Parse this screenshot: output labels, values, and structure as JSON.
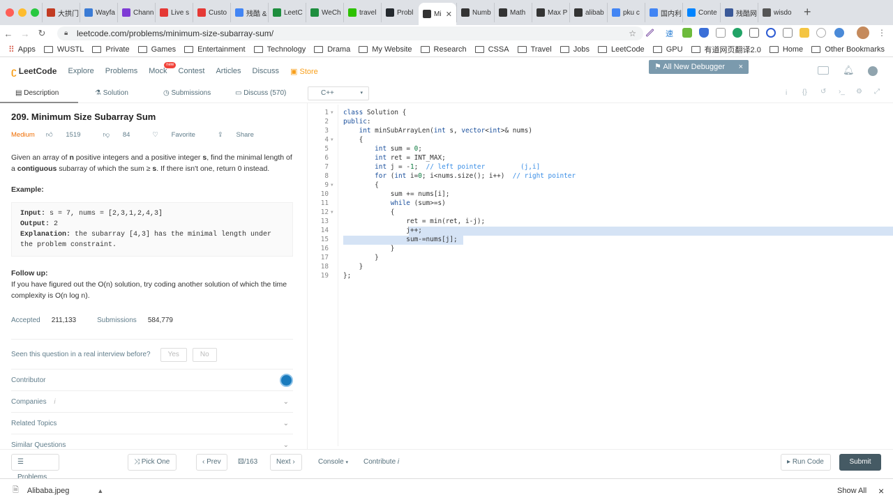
{
  "browser": {
    "tabs": [
      "大拱门",
      "Wayfa",
      "Chann",
      "Live s",
      "Custo",
      "残酷 &",
      "LeetC",
      "WeCh",
      "travel",
      "Probl",
      "Mi",
      "Numb",
      "Math",
      "Max P",
      "alibab",
      "pku c",
      "国内利",
      "Conte",
      "残酷网",
      "wisdo"
    ],
    "active_tab_index": 10,
    "url": "leetcode.com/problems/minimum-size-subarray-sum/",
    "bookmarks": [
      "Apps",
      "WUSTL",
      "Private",
      "Games",
      "Entertainment",
      "Technology",
      "Drama",
      "My Website",
      "Research",
      "CSSA",
      "Travel",
      "Jobs",
      "LeetCode",
      "GPU",
      "有道网页翻译2.0",
      "Home"
    ],
    "other_bookmarks": "Other Bookmarks"
  },
  "lc": {
    "logo": "LeetCode",
    "nav": [
      "Explore",
      "Problems",
      "Mock",
      "Contest",
      "Articles",
      "Discuss",
      "Store"
    ],
    "mock_badge": "new",
    "promo": "All New Debugger"
  },
  "subtabs": {
    "description": "Description",
    "solution": "Solution",
    "submissions": "Submissions",
    "discuss": "Discuss (570)",
    "language": "C++"
  },
  "problem": {
    "title": "209. Minimum Size Subarray Sum",
    "difficulty": "Medium",
    "likes": "1519",
    "dislikes": "84",
    "favorite": "Favorite",
    "share": "Share",
    "desc_1": "Given an array of ",
    "desc_n": "n",
    "desc_2": " positive integers and a positive integer ",
    "desc_s": "s",
    "desc_3": ", find the minimal length of a ",
    "desc_contig": "contiguous",
    "desc_4": " subarray of which the sum ≥ ",
    "desc_s2": "s",
    "desc_5": ". If there isn't one, return 0 instead.",
    "example_heading": "Example:",
    "ex_input_label": "Input:",
    "ex_input": " s = 7, nums = [2,3,1,2,4,3]",
    "ex_output_label": "Output:",
    "ex_output": " 2",
    "ex_expl_label": "Explanation:",
    "ex_expl": " the subarray [4,3] has the minimal length under",
    "ex_expl2": "the problem constraint.",
    "followup_heading": "Follow up:",
    "followup": "If you have figured out the O(n) solution, try coding another solution of which the time complexity is O(n log n).",
    "accepted_label": "Accepted",
    "accepted": "211,133",
    "submissions_label": "Submissions",
    "submissions": "584,779",
    "seen_q": "Seen this question in a real interview before?",
    "yes": "Yes",
    "no": "No",
    "contributor": "Contributor",
    "companies": "Companies",
    "related": "Related Topics",
    "similar": "Similar Questions"
  },
  "code": [
    "class Solution {",
    "public:",
    "    int minSubArrayLen(int s, vector<int>& nums)",
    "    {",
    "        int sum = 0;",
    "        int ret = INT_MAX;",
    "        int j = -1;  // left pointer         (j,i]",
    "        for (int i=0; i<nums.size(); i++)  // right pointer",
    "        {",
    "            sum += nums[i];",
    "            while (sum>=s)",
    "            {",
    "                ret = min(ret, i-j);",
    "                j++;",
    "                sum-=nums[j];",
    "            }",
    "        }",
    "    }",
    "};"
  ],
  "bottom": {
    "problems": "Problems",
    "pick_one": "Pick One",
    "prev": "Prev",
    "page": "/163",
    "next": "Next",
    "console": "Console",
    "contribute": "Contribute",
    "run": "Run Code",
    "submit": "Submit"
  },
  "download": {
    "file": "Alibaba.jpeg",
    "show_all": "Show All"
  }
}
